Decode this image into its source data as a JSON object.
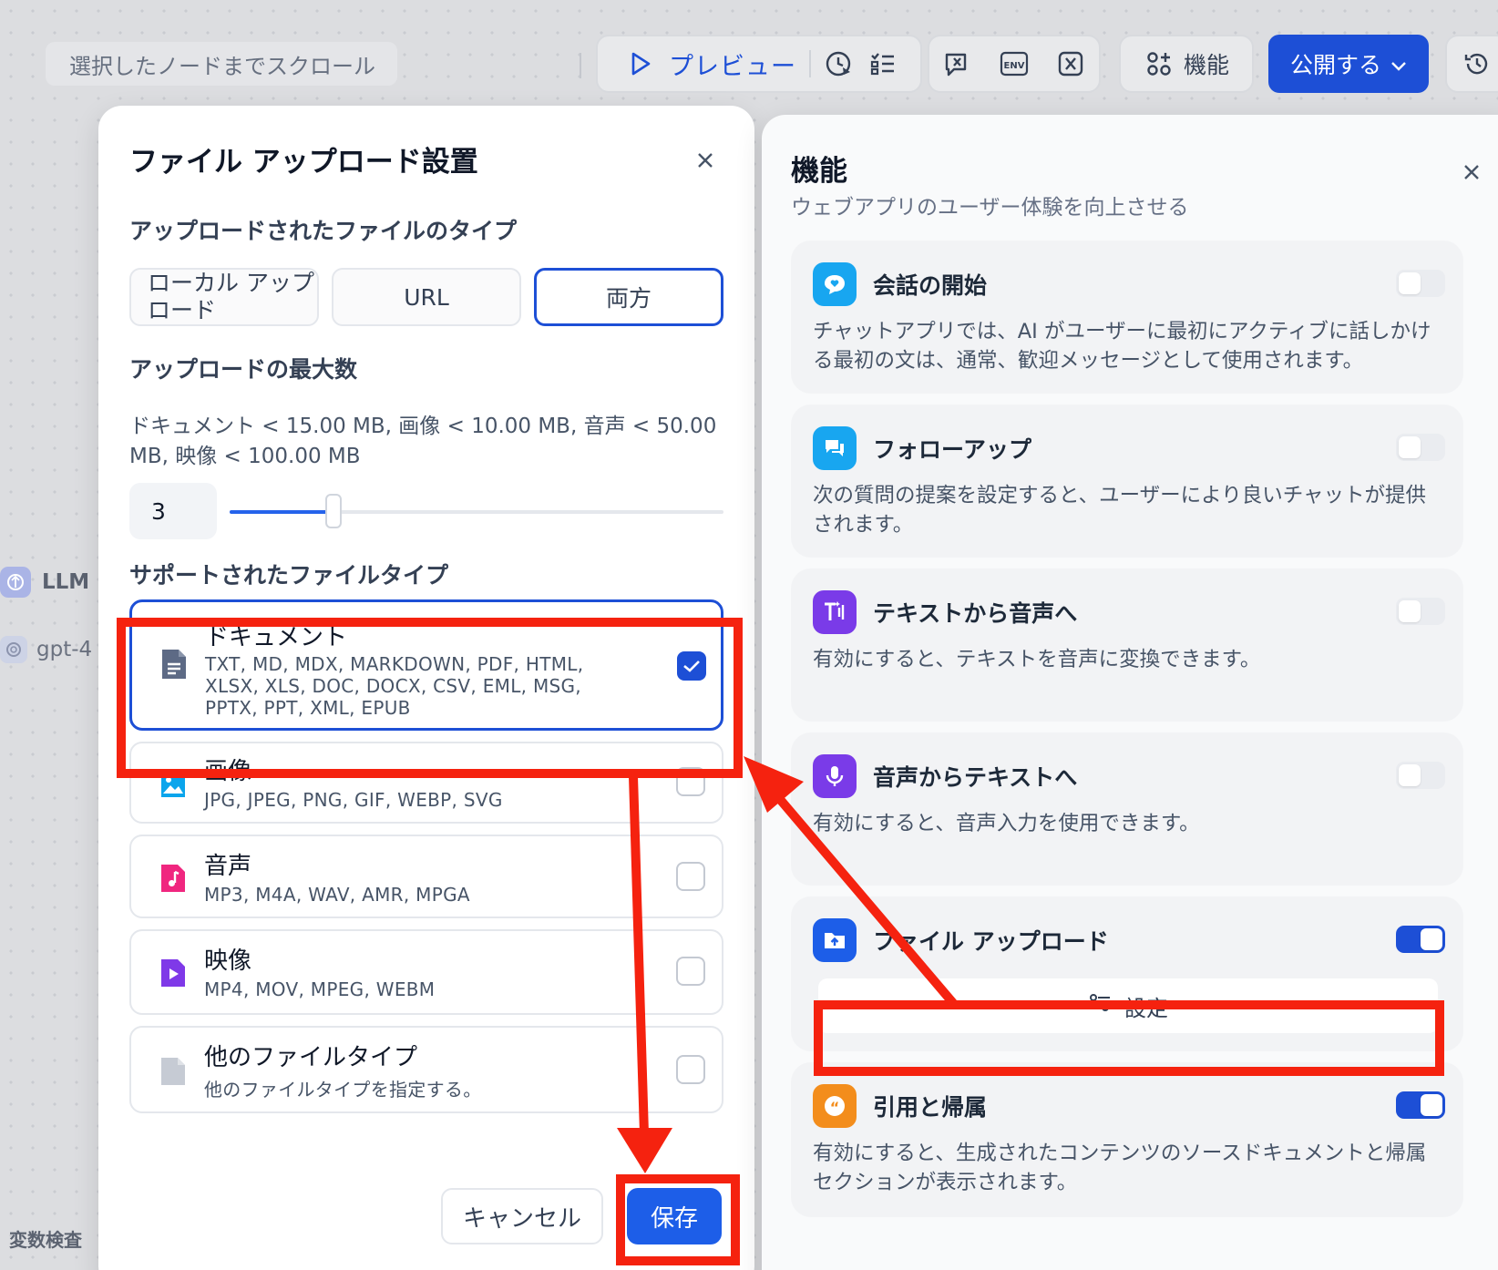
{
  "toolbar": {
    "scroll_label": "選択したノードまでスクロール",
    "preview_label": "プレビュー",
    "features_label": "機能",
    "publish_label": "公開する"
  },
  "canvas": {
    "llm_label": "LLM",
    "model_label": "gpt-4",
    "var_inspect_label": "変数検査"
  },
  "modal": {
    "title": "ファイル アップロード設置",
    "upload_type_label": "アップロードされたファイルのタイプ",
    "upload_types": [
      {
        "label": "ローカル アップロード",
        "selected": false
      },
      {
        "label": "URL",
        "selected": false
      },
      {
        "label": "両方",
        "selected": true
      }
    ],
    "max_label": "アップロードの最大数",
    "limits_text": "ドキュメント < 15.00 MB, 画像 < 10.00 MB, 音声 < 50.00 MB, 映像 < 100.00 MB",
    "max_value": "3",
    "slider_fraction": 0.21,
    "supported_label": "サポートされたファイルタイプ",
    "file_types": [
      {
        "name": "ドキュメント",
        "ext": "TXT, MD, MDX, MARKDOWN, PDF, HTML, XLSX, XLS, DOC, DOCX, CSV, EML, MSG, PPTX, PPT, XML, EPUB",
        "checked": true,
        "icon": "document-icon",
        "color": "#5d6a85"
      },
      {
        "name": "画像",
        "ext": "JPG, JPEG, PNG, GIF, WEBP, SVG",
        "checked": false,
        "icon": "image-icon",
        "color": "#0ba5ec"
      },
      {
        "name": "音声",
        "ext": "MP3, M4A, WAV, AMR, MPGA",
        "checked": false,
        "icon": "audio-icon",
        "color": "#f0267f"
      },
      {
        "name": "映像",
        "ext": "MP4, MOV, MPEG, WEBM",
        "checked": false,
        "icon": "video-icon",
        "color": "#7f39e8"
      },
      {
        "name": "他のファイルタイプ",
        "ext": "他のファイルタイプを指定する。",
        "checked": false,
        "icon": "file-icon",
        "color": "#c6cbd4"
      }
    ],
    "cancel_label": "キャンセル",
    "save_label": "保存"
  },
  "features": {
    "title": "機能",
    "subtitle": "ウェブアプリのユーザー体験を向上させる",
    "items": [
      {
        "title": "会話の開始",
        "desc": "チャットアプリでは、AI がユーザーに最初にアクティブに話しかける最初の文は、通常、歓迎メッセージとして使用されます。",
        "enabled": false,
        "icon": "chat-bubble-icon",
        "color": "#18a6f0"
      },
      {
        "title": "フォローアップ",
        "desc": "次の質問の提案を設定すると、ユーザーにより良いチャットが提供されます。",
        "enabled": false,
        "icon": "messages-icon",
        "color": "#18a6f0"
      },
      {
        "title": "テキストから音声へ",
        "desc": "有効にすると、テキストを音声に変換できます。",
        "enabled": false,
        "icon": "text-to-speech-icon",
        "color": "#7a3be8"
      },
      {
        "title": "音声からテキストへ",
        "desc": "有効にすると、音声入力を使用できます。",
        "enabled": false,
        "icon": "microphone-icon",
        "color": "#7a3be8"
      },
      {
        "title": "ファイル アップロード",
        "desc": "",
        "enabled": true,
        "icon": "folder-upload-icon",
        "color": "#1d5ee8",
        "settings_label": "設定"
      },
      {
        "title": "引用と帰属",
        "desc": "有効にすると、生成されたコンテンツのソースドキュメントと帰属セクションが表示されます。",
        "enabled": true,
        "icon": "quote-icon",
        "color": "#f38d1c"
      }
    ]
  },
  "colors": {
    "accent": "#1d4fd6",
    "annotation": "#f5220f"
  }
}
